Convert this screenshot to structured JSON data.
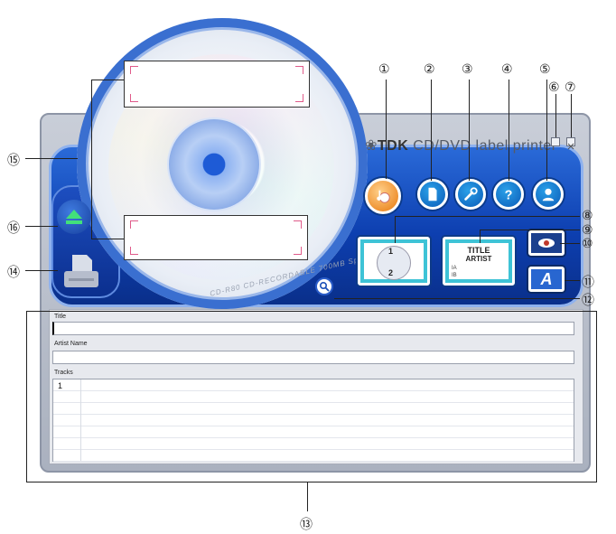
{
  "app": {
    "brand_logo": "TDK",
    "brand_text": "CD/DVD label printer"
  },
  "cd": {
    "disc_text": "CD-R80  CD-RECORDABLE 700MB  Speed"
  },
  "buttons": {
    "music": {
      "icon": "music-disc-icon"
    },
    "new": {
      "icon": "new-document-icon"
    },
    "settings": {
      "icon": "wrench-icon"
    },
    "help": {
      "icon": "question-icon"
    },
    "user": {
      "icon": "user-icon"
    },
    "minimize": {
      "icon": "minimize-icon"
    },
    "close": {
      "icon": "close-icon"
    },
    "eye": {
      "icon": "eye-icon"
    },
    "font": {
      "label": "A"
    },
    "zoom": {
      "icon": "magnifier-icon"
    },
    "eject": {
      "icon": "eject-icon"
    },
    "print": {
      "icon": "printer-icon"
    }
  },
  "layouts": {
    "disc": {
      "label_1": "1",
      "label_2": "2"
    },
    "title": {
      "title": "TITLE",
      "artist": "ARTIST",
      "row_a": "IA",
      "row_b": "IB"
    }
  },
  "form": {
    "title_label": "Title",
    "title_value": "",
    "artist_label": "Artist Name",
    "artist_value": "",
    "tracks_label": "Tracks",
    "tracks": [
      {
        "num": "1",
        "name": ""
      }
    ]
  },
  "callouts": {
    "c1": "①",
    "c2": "②",
    "c3": "③",
    "c4": "④",
    "c5": "⑤",
    "c6": "⑥",
    "c7": "⑦",
    "c8": "⑧",
    "c9": "⑨",
    "c10": "⑩",
    "c11": "⑪",
    "c12": "⑫",
    "c13": "⑬",
    "c14": "⑭",
    "c15": "⑮",
    "c16": "⑯"
  },
  "colors": {
    "panel_blue": "#0d3fb0",
    "button_blue": "#0b5cb8",
    "music_orange": "#e8780c",
    "layout_cyan": "#3ec3d6"
  }
}
